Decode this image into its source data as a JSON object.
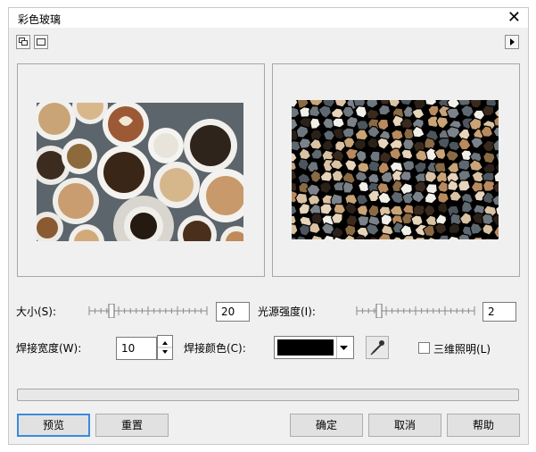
{
  "window": {
    "title": "彩色玻璃"
  },
  "controls": {
    "size_label": "大小(S):",
    "size_value": "20",
    "light_label": "光源强度(I):",
    "light_value": "2",
    "weld_width_label": "焊接宽度(W):",
    "weld_width_value": "10",
    "weld_color_label": "焊接颜色(C):",
    "weld_color_value": "#000000",
    "lighting3d_label": "三维照明(L)",
    "lighting3d_checked": false
  },
  "buttons": {
    "preview": "预览",
    "reset": "重置",
    "ok": "确定",
    "cancel": "取消",
    "help": "帮助"
  },
  "icons": {
    "toolbar_left_1": "dual-preview-icon",
    "toolbar_left_2": "single-preview-icon",
    "toolbar_right": "play-arrow-icon",
    "eyedropper": "eyedropper-icon"
  }
}
